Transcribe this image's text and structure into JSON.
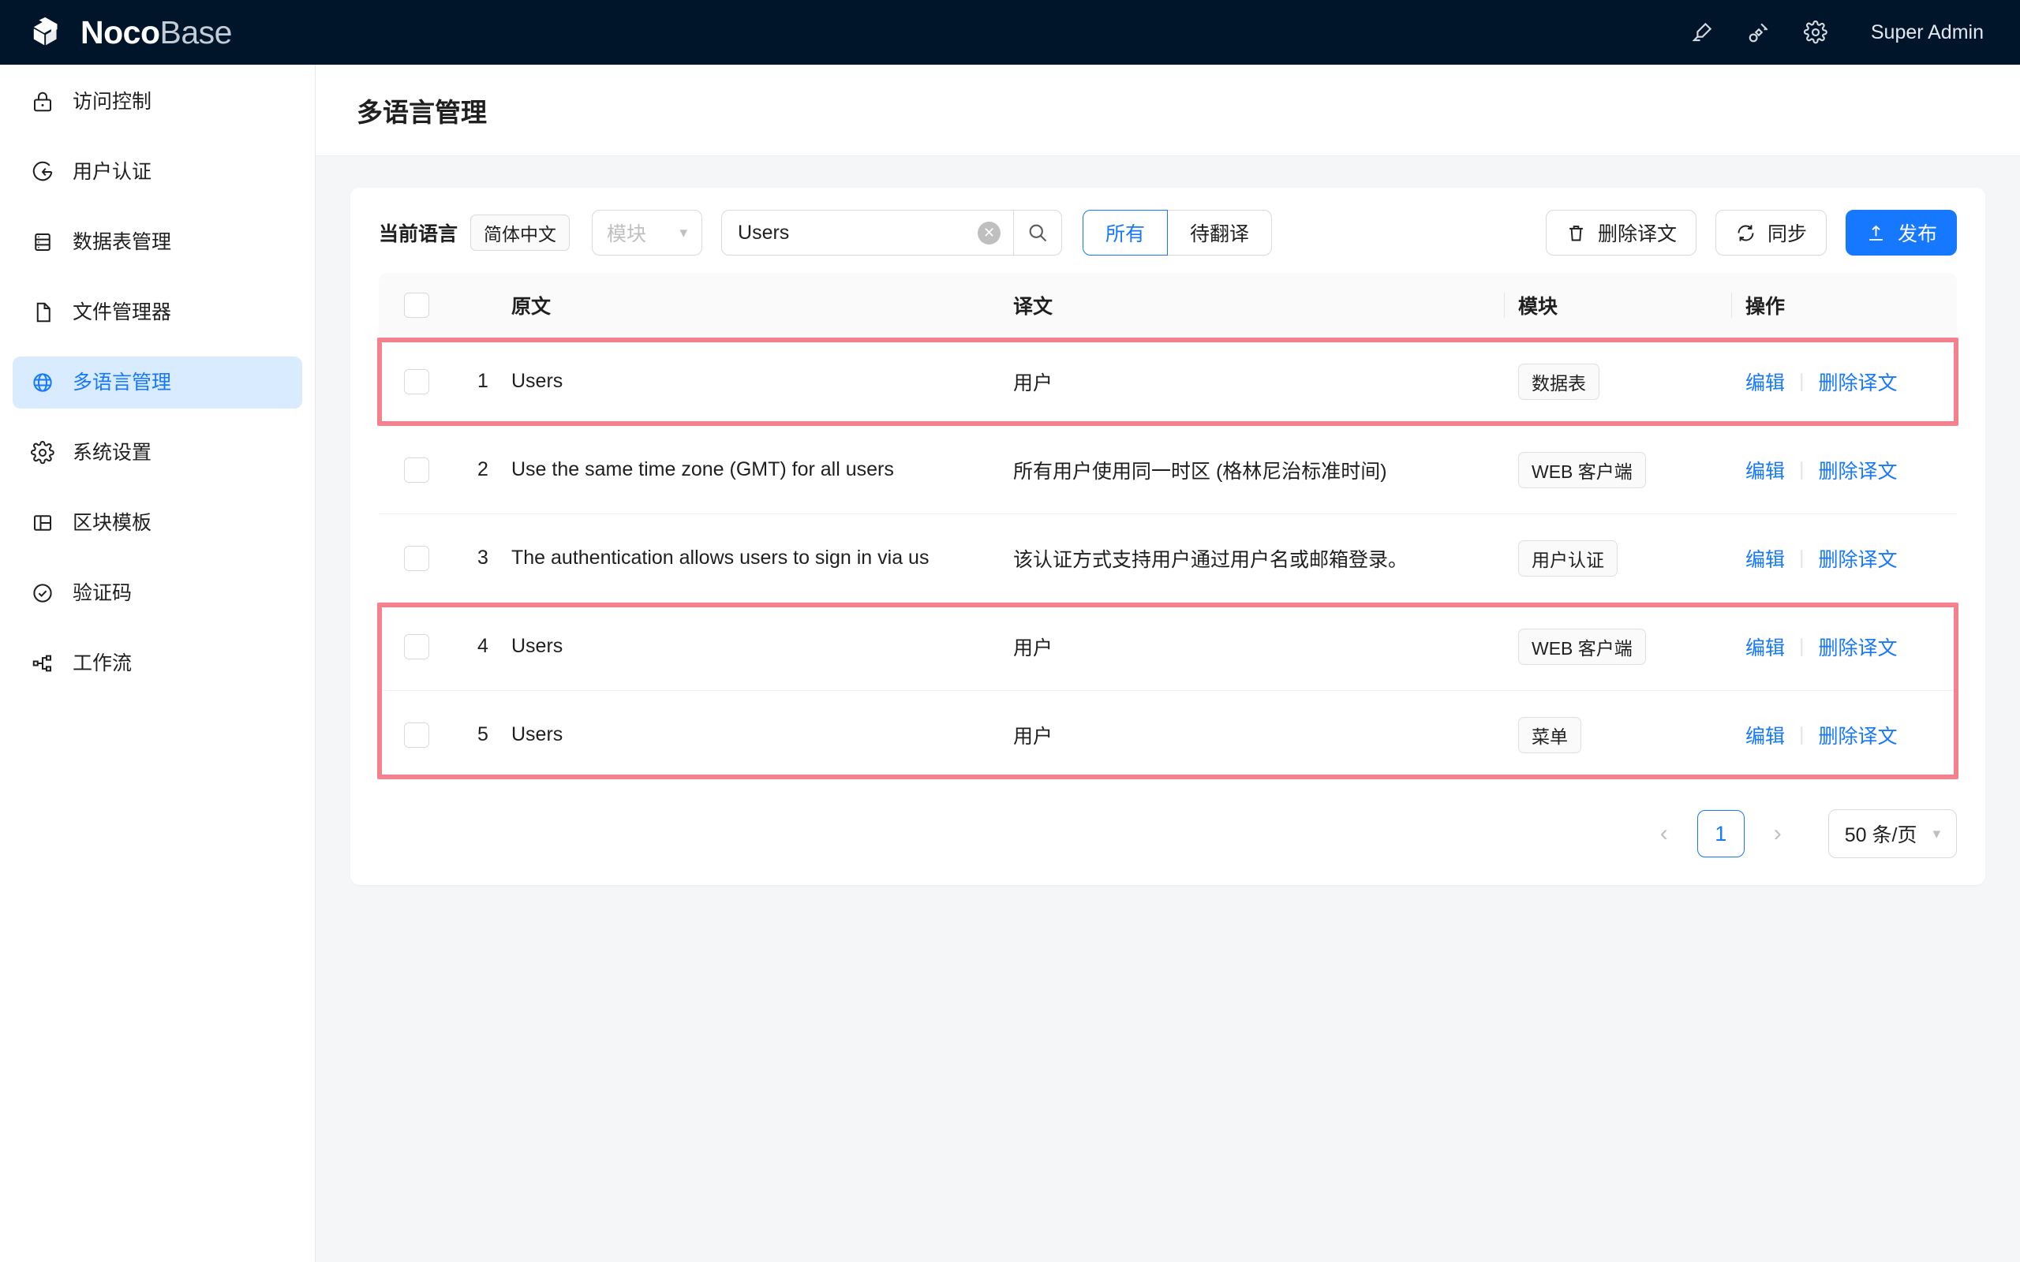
{
  "header": {
    "brand_primary": "Noco",
    "brand_secondary": "Base",
    "user": "Super Admin",
    "icons": [
      "highlighter-icon",
      "plugin-icon",
      "gear-icon"
    ]
  },
  "sidebar": {
    "items": [
      {
        "label": "访问控制",
        "icon": "lock-icon",
        "active": false
      },
      {
        "label": "用户认证",
        "icon": "sign-in-icon",
        "active": false
      },
      {
        "label": "数据表管理",
        "icon": "database-icon",
        "active": false
      },
      {
        "label": "文件管理器",
        "icon": "file-icon",
        "active": false
      },
      {
        "label": "多语言管理",
        "icon": "globe-icon",
        "active": true
      },
      {
        "label": "系统设置",
        "icon": "gear-icon",
        "active": false
      },
      {
        "label": "区块模板",
        "icon": "layout-icon",
        "active": false
      },
      {
        "label": "验证码",
        "icon": "check-circle-icon",
        "active": false
      },
      {
        "label": "工作流",
        "icon": "workflow-icon",
        "active": false
      }
    ]
  },
  "page": {
    "title": "多语言管理"
  },
  "toolbar": {
    "current_language_label": "当前语言",
    "current_language_value": "简体中文",
    "module_placeholder": "模块",
    "search_value": "Users",
    "clear_icon": "close-circle-icon",
    "search_icon": "search-icon",
    "tabs": [
      {
        "label": "所有",
        "active": true
      },
      {
        "label": "待翻译",
        "active": false
      }
    ],
    "delete_translation_label": "删除译文",
    "delete_icon": "trash-icon",
    "sync_label": "同步",
    "sync_icon": "refresh-icon",
    "publish_label": "发布",
    "publish_icon": "upload-icon"
  },
  "table": {
    "columns": [
      "原文",
      "译文",
      "模块",
      "操作"
    ],
    "action_edit": "编辑",
    "action_delete": "删除译文",
    "rows": [
      {
        "index": "1",
        "source": "Users",
        "translation": "用户",
        "module": "数据表"
      },
      {
        "index": "2",
        "source": "Use the same time zone (GMT) for all users",
        "translation": "所有用户使用同一时区 (格林尼治标准时间)",
        "module": "WEB 客户端"
      },
      {
        "index": "3",
        "source": "The authentication allows users to sign in via us",
        "translation": "该认证方式支持用户通过用户名或邮箱登录。",
        "module": "用户认证"
      },
      {
        "index": "4",
        "source": "Users",
        "translation": "用户",
        "module": "WEB 客户端"
      },
      {
        "index": "5",
        "source": "Users",
        "translation": "用户",
        "module": "菜单"
      }
    ]
  },
  "pagination": {
    "prev_icon": "chevron-left-icon",
    "next_icon": "chevron-right-icon",
    "current_page": "1",
    "page_size": "50 条/页"
  },
  "colors": {
    "header_bg": "#001529",
    "accent": "#1677ff",
    "highlight_border": "#f5818f",
    "content_bg": "#f5f6f7"
  }
}
